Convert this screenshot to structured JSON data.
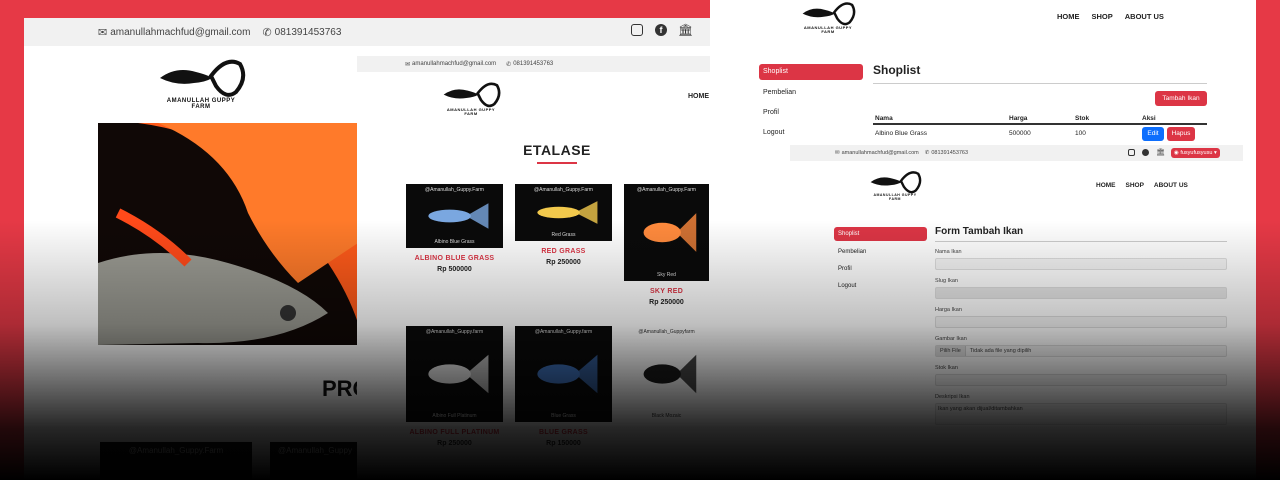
{
  "contact": {
    "email": "amanullahmachfud@gmail.com",
    "phone": "081391453763"
  },
  "logo": {
    "line1": "AMANULLAH GUPPY",
    "line2": "FARM"
  },
  "nav": {
    "home": "HOME",
    "shop": "SHOP",
    "about": "ABOUT US"
  },
  "user_menu": {
    "label": "fusyufusyusu"
  },
  "home_page": {
    "heading_partial": "PRO",
    "card_watermarks": [
      "@Amanullah_Guppy.Farm",
      "@Amanullah_Guppy"
    ]
  },
  "etalase": {
    "title": "ETALASE",
    "nav_partial": "HOME",
    "products": [
      {
        "name": "ALBINO BLUE GRASS",
        "price": "Rp 500000",
        "watermark": "@Amanullah_Guppy.Farm",
        "caption": "Albino Blue Grass"
      },
      {
        "name": "RED GRASS",
        "price": "Rp 250000",
        "watermark": "@Amanullah_Guppy.Farm",
        "caption": "Red Grass"
      },
      {
        "name": "SKY RED",
        "price": "Rp 250000",
        "watermark": "@Amanullah_Guppy.Farm",
        "caption": "Sky Red"
      },
      {
        "name": "ALBINO FULL PLATINUM",
        "price": "Rp 250000",
        "watermark": "@Amanullah_Guppy.farm",
        "caption": "Albino Full Platinum"
      },
      {
        "name": "BLUE GRASS",
        "price": "Rp 150000",
        "watermark": "@Amanullah_Guppy.farm",
        "caption": "Blue Grass"
      },
      {
        "name": "",
        "price": "",
        "watermark": "@Amanullah_Guppyfarm",
        "caption": "Black Mozaic"
      }
    ]
  },
  "admin_sidebar": {
    "items": [
      "Shoplist",
      "Pembelian",
      "Profil",
      "Logout"
    ]
  },
  "shoplist": {
    "title": "Shoplist",
    "add_button": "Tambah Ikan",
    "columns": [
      "Nama",
      "Harga",
      "Stok",
      "Aksi"
    ],
    "rows": [
      {
        "nama": "Albino Blue Grass",
        "harga": "500000",
        "stok": "100"
      }
    ],
    "edit": "Edit",
    "delete": "Hapus"
  },
  "form": {
    "title": "Form Tambah Ikan",
    "labels": [
      "Nama Ikan",
      "Slug Ikan",
      "Harga Ikan",
      "Gambar Ikan",
      "Stok Ikan",
      "Deskripsi Ikan"
    ],
    "file_button": "Pilih File",
    "file_placeholder": "Tidak ada file yang dipilih",
    "description_placeholder": "Ikan yang akan dijual/ditambahkan"
  }
}
